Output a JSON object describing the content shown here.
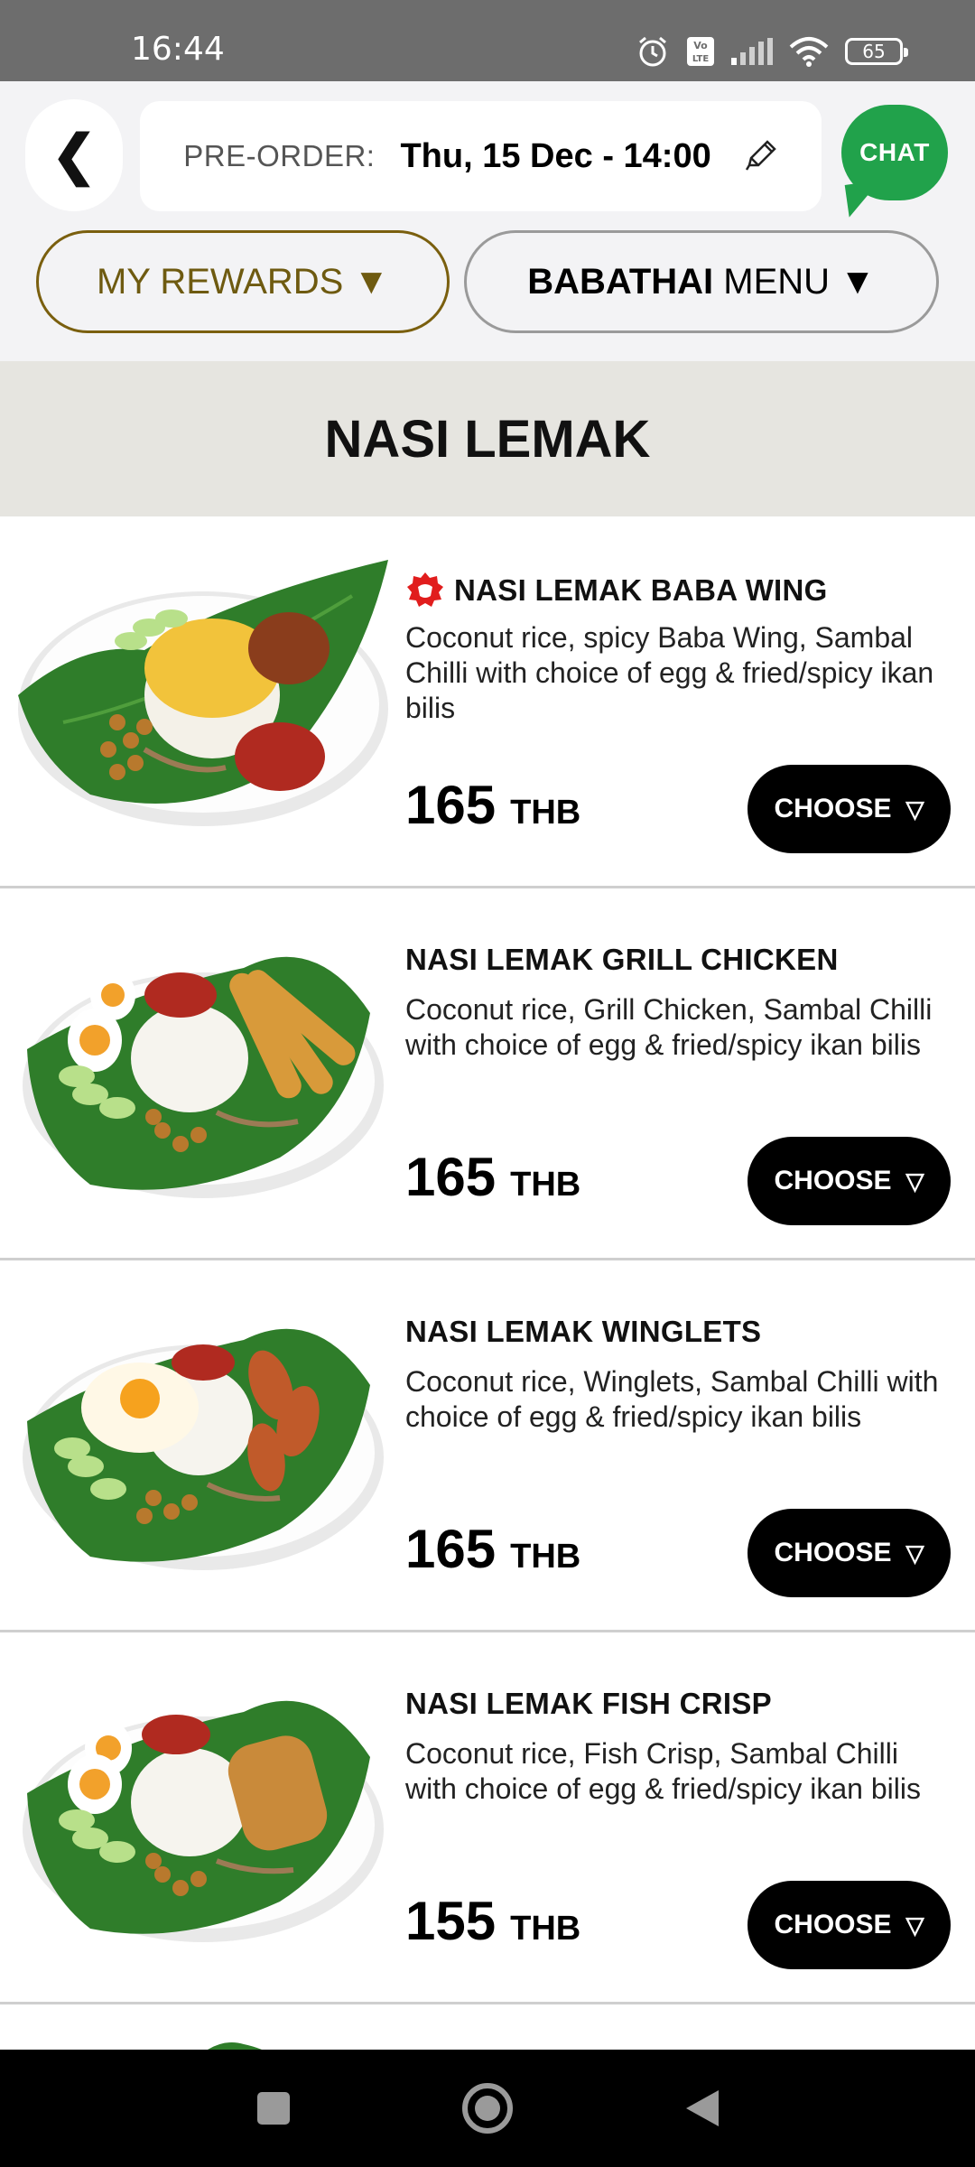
{
  "status_bar": {
    "time": "16:44",
    "battery": "65",
    "icons": [
      "alarm-icon",
      "volte-icon",
      "signal-icon",
      "wifi-icon",
      "battery-icon"
    ]
  },
  "header": {
    "back_label": "❮",
    "preorder_label": "PRE-ORDER:",
    "preorder_value": "Thu, 15 Dec - 14:00",
    "chat_label": "CHAT",
    "rewards_label": "MY REWARDS ▼",
    "menu_label_bold": "BABATHAI",
    "menu_label_rest": "MENU ▼"
  },
  "section": {
    "title": "NASI LEMAK"
  },
  "items": [
    {
      "name": "NASI LEMAK BABA WING",
      "description": "Coconut rice, spicy Baba Wing, Sambal Chilli with choice of egg & fried/spicy ikan bilis",
      "price": "165",
      "currency": "THB",
      "button": "CHOOSE",
      "spicy_badge": true
    },
    {
      "name": "NASI LEMAK GRILL CHICKEN",
      "description": "Coconut rice, Grill Chicken, Sambal Chilli with choice of egg & fried/spicy ikan bilis",
      "price": "165",
      "currency": "THB",
      "button": "CHOOSE"
    },
    {
      "name": "NASI LEMAK WINGLETS",
      "description": "Coconut rice, Winglets, Sambal Chilli with choice of egg & fried/spicy ikan bilis",
      "price": "165",
      "currency": "THB",
      "button": "CHOOSE"
    },
    {
      "name": "NASI LEMAK FISH CRISP",
      "description": "Coconut rice, Fish Crisp, Sambal Chilli with choice of egg & fried/spicy ikan bilis",
      "price": "155",
      "currency": "THB",
      "button": "CHOOSE"
    }
  ],
  "colors": {
    "chat_green": "#21a24b",
    "rewards_gold": "#7a5f0e",
    "section_bg": "#e6e5e0",
    "button_black": "#000000"
  }
}
